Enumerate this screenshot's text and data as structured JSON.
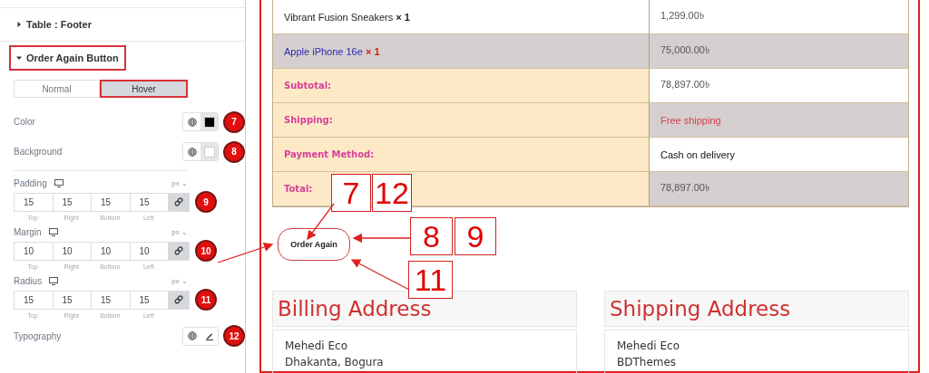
{
  "sidebar": {
    "sections": [
      {
        "title": "Table : Footer",
        "expanded": false,
        "highlighted": false
      },
      {
        "title": "Order Again Button",
        "expanded": true,
        "highlighted": true
      }
    ],
    "state_tabs": [
      {
        "label": "Normal",
        "selected": false,
        "highlighted": false
      },
      {
        "label": "Hover",
        "selected": true,
        "highlighted": true
      }
    ],
    "controls": [
      {
        "kind": "color",
        "label": "Color",
        "color": "#000000",
        "badge": "7"
      },
      {
        "kind": "color",
        "label": "Background",
        "color": "#ffffff",
        "badge": "8"
      },
      {
        "kind": "dimensions",
        "label": "Padding",
        "unit": "px ⌄",
        "values": [
          "15",
          "15",
          "15",
          "15"
        ],
        "sides": [
          "Top",
          "Right",
          "Bottom",
          "Left"
        ],
        "badge": "9"
      },
      {
        "kind": "dimensions",
        "label": "Margin",
        "unit": "px ⌄",
        "values": [
          "10",
          "10",
          "10",
          "10"
        ],
        "sides": [
          "Top",
          "Right",
          "Bottom",
          "Left"
        ],
        "badge": "10"
      },
      {
        "kind": "dimensions",
        "label": "Radius",
        "unit": "px ⌄",
        "values": [
          "15",
          "15",
          "15",
          "15"
        ],
        "sides": [
          "Top",
          "Right",
          "Bottom",
          "Left"
        ],
        "badge": "11"
      },
      {
        "kind": "typography",
        "label": "Typography",
        "badge": "12"
      }
    ]
  },
  "order_table": {
    "rows": [
      {
        "kind": "item",
        "name": "Vibrant Fusion Sneakers",
        "qty": "× 1",
        "value": "1,299.00৳",
        "shaded": false
      },
      {
        "kind": "item",
        "name": "Apple iPhone 16e",
        "qty": "× 1",
        "value": "75,000.00৳",
        "shaded": true
      },
      {
        "kind": "total",
        "name": "Subtotal:",
        "value": "78,897.00৳",
        "shaded": false
      },
      {
        "kind": "total",
        "name": "Shipping:",
        "value": "Free shipping",
        "shaded": true
      },
      {
        "kind": "total",
        "name": "Payment Method:",
        "value": "Cash on delivery",
        "shaded": false
      },
      {
        "kind": "total",
        "name": "Total:",
        "value": "78,897.00৳",
        "shaded": true
      }
    ]
  },
  "order_again_button": "Order Again",
  "annotations": [
    "7",
    "12",
    "8",
    "9",
    "11"
  ],
  "addresses": [
    {
      "title": "Billing Address",
      "lines": [
        "Mehedi Eco",
        "Dhakanta, Bogura"
      ]
    },
    {
      "title": "Shipping Address",
      "lines": [
        "Mehedi Eco",
        "BDThemes"
      ]
    }
  ]
}
